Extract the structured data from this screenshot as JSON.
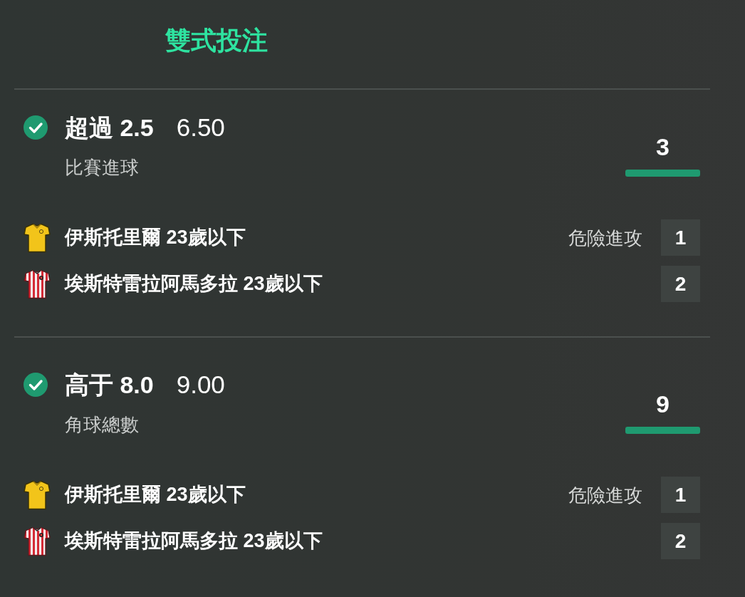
{
  "header": {
    "title": "雙式投注"
  },
  "bets": [
    {
      "won": true,
      "selection": "超過 2.5",
      "odds": "6.50",
      "market": "比賽進球",
      "score": "3",
      "teams": [
        {
          "name": "伊斯托里爾 23歲以下",
          "stat_label": "危險進攻",
          "value": "1"
        },
        {
          "name": "埃斯特雷拉阿馬多拉 23歲以下",
          "value": "2"
        }
      ]
    },
    {
      "won": true,
      "selection": "高于 8.0",
      "odds": "9.00",
      "market": "角球總數",
      "score": "9",
      "teams": [
        {
          "name": "伊斯托里爾 23歲以下",
          "stat_label": "危險進攻",
          "value": "1"
        },
        {
          "name": "埃斯特雷拉阿馬多拉 23歲以下",
          "value": "2"
        }
      ]
    }
  ]
}
